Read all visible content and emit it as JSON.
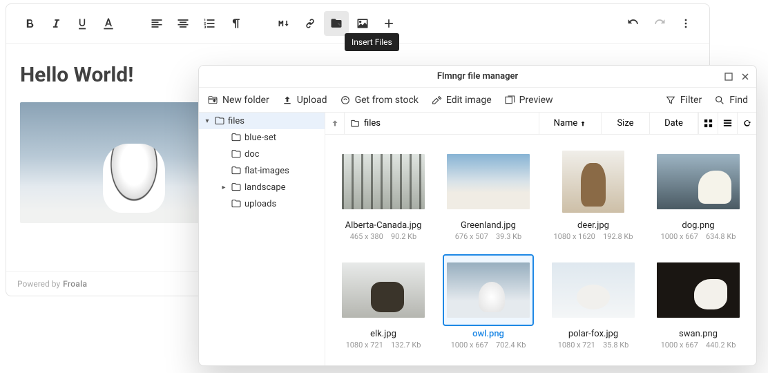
{
  "toolbar": {
    "tooltip": "Insert Files"
  },
  "editor": {
    "heading": "Hello World!"
  },
  "footer": {
    "prefix": "Powered by",
    "brand": "Froala"
  },
  "fm": {
    "title": "Flmngr file manager",
    "actions": {
      "newfolder": "New folder",
      "upload": "Upload",
      "stock": "Get from stock",
      "editimage": "Edit image",
      "preview": "Preview",
      "filter": "Filter",
      "find": "Find"
    },
    "tree": {
      "root": "files",
      "children": [
        "blue-set",
        "doc",
        "flat-images",
        "landscape",
        "uploads"
      ],
      "expandable": [
        "landscape"
      ]
    },
    "bar": {
      "breadcrumb": "files",
      "name": "Name",
      "size": "Size",
      "date": "Date"
    },
    "files": [
      {
        "name": "Alberta-Canada.jpg",
        "dim": "465 x 380",
        "size": "90.2 Kb",
        "art": "t-forest",
        "shape": ""
      },
      {
        "name": "Greenland.jpg",
        "dim": "676 x 507",
        "size": "39.3 Kb",
        "art": "t-snow",
        "shape": ""
      },
      {
        "name": "deer.jpg",
        "dim": "1080 x 1620",
        "size": "192.8 Kb",
        "art": "t-deer",
        "shape": "square"
      },
      {
        "name": "dog.png",
        "dim": "1000 x 667",
        "size": "634.8 Kb",
        "art": "t-dog",
        "shape": ""
      },
      {
        "name": "elk.jpg",
        "dim": "1080 x 721",
        "size": "132.7 Kb",
        "art": "t-elk",
        "shape": ""
      },
      {
        "name": "owl.png",
        "dim": "1000 x 667",
        "size": "702.4 Kb",
        "art": "t-owl",
        "shape": "",
        "selected": true
      },
      {
        "name": "polar-fox.jpg",
        "dim": "1080 x 721",
        "size": "35.8 Kb",
        "art": "t-fox",
        "shape": ""
      },
      {
        "name": "swan.png",
        "dim": "1000 x 667",
        "size": "440.2 Kb",
        "art": "t-swan",
        "shape": ""
      }
    ]
  }
}
